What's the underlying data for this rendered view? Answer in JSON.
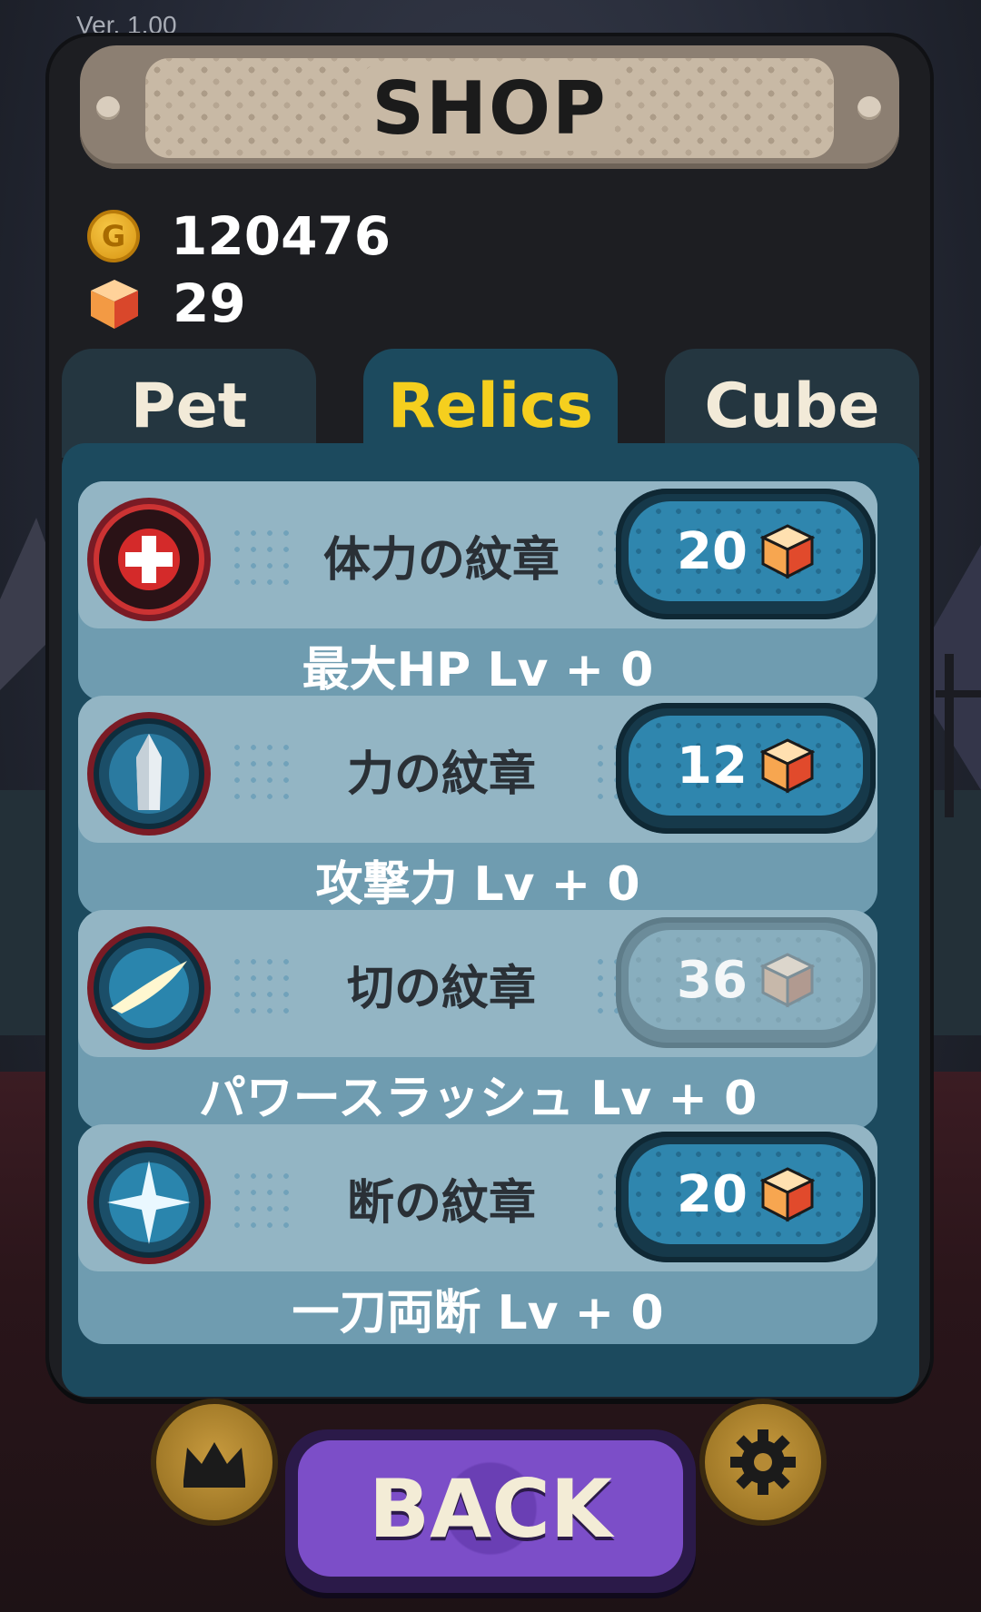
{
  "version_label": "Ver. 1.00",
  "shop": {
    "title": "SHOP"
  },
  "currency": {
    "gold": "120476",
    "cubes": "29"
  },
  "tabs": [
    {
      "label": "Pet",
      "active": false
    },
    {
      "label": "Relics",
      "active": true
    },
    {
      "label": "Cube",
      "active": false
    }
  ],
  "relics": [
    {
      "name": "体力の紋章",
      "price": "20",
      "effect": "最大HP Lv + 0",
      "icon": "health-emblem-icon",
      "affordable": true
    },
    {
      "name": "力の紋章",
      "price": "12",
      "effect": "攻撃力 Lv + 0",
      "icon": "power-emblem-icon",
      "affordable": true
    },
    {
      "name": "切の紋章",
      "price": "36",
      "effect": "パワースラッシュ Lv + 0",
      "icon": "slash-emblem-icon",
      "affordable": false
    },
    {
      "name": "断の紋章",
      "price": "20",
      "effect": "一刀両断 Lv + 0",
      "icon": "cleave-emblem-icon",
      "affordable": true
    }
  ],
  "back_button": {
    "label": "BACK"
  },
  "colors": {
    "active_tab": "#f5cf1e",
    "panel_bg": "#1d1e22",
    "list_bg": "#1c4a5e",
    "back_button": "#7c4ec8"
  }
}
